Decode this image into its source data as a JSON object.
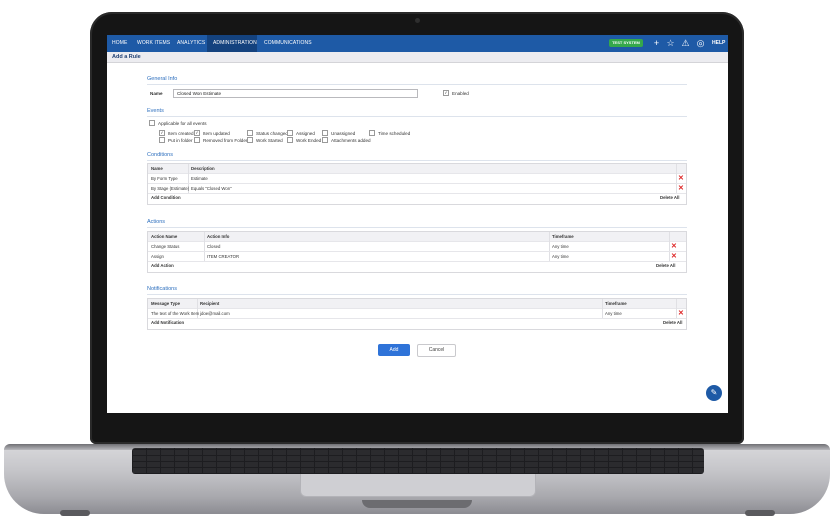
{
  "nav": {
    "items": [
      "HOME",
      "WORK ITEMS",
      "ANALYTICS",
      "ADMINISTRATION",
      "COMMUNICATIONS"
    ],
    "active": "ADMINISTRATION",
    "system_badge": "TEST SYSTEM",
    "icons": [
      "plus-icon",
      "star-icon",
      "alert-icon",
      "user-icon"
    ],
    "help": "HELP"
  },
  "page": {
    "title": "Add a Rule"
  },
  "general": {
    "heading": "General Info",
    "name_label": "Name",
    "name_value": "Closed Won Estimate",
    "enabled_label": "Enabled",
    "enabled": true
  },
  "events": {
    "heading": "Events",
    "applicable_all": "Applicable for all events",
    "row1": [
      {
        "label": "Item created",
        "checked": true
      },
      {
        "label": "Item updated",
        "checked": true
      },
      {
        "label": "Status changed",
        "checked": false
      },
      {
        "label": "Assigned",
        "checked": false
      },
      {
        "label": "Unassigned",
        "checked": false
      },
      {
        "label": "Time scheduled",
        "checked": false
      }
    ],
    "row2": [
      {
        "label": "Put in folder",
        "checked": false
      },
      {
        "label": "Removed from Folder",
        "checked": false
      },
      {
        "label": "Work Started",
        "checked": false
      },
      {
        "label": "Work Ended",
        "checked": false
      },
      {
        "label": "Attachments added",
        "checked": false
      }
    ]
  },
  "conditions": {
    "heading": "Conditions",
    "columns": [
      "Name",
      "Description"
    ],
    "rows": [
      {
        "name": "By Form Type",
        "description": "Estimate"
      },
      {
        "name": "By Stage (Estimate)",
        "description": "Equals \"Closed Won\""
      }
    ],
    "add": "Add Condition",
    "delete_all": "Delete All"
  },
  "actions": {
    "heading": "Actions",
    "columns": [
      "Action Name",
      "Action Info",
      "Timeframe"
    ],
    "rows": [
      {
        "name": "Change Status",
        "info": "Closed",
        "timeframe": "Any time"
      },
      {
        "name": "Assign",
        "info": "ITEM CREATOR",
        "timeframe": "Any time"
      }
    ],
    "add": "Add Action",
    "delete_all": "Delete All"
  },
  "notifications": {
    "heading": "Notifications",
    "columns": [
      "Message Type",
      "Recipient",
      "Timeframe"
    ],
    "rows": [
      {
        "type": "The text of the Work Item",
        "recipient": "jdoe@mail.com",
        "timeframe": "Any time"
      }
    ],
    "add": "Add Notification",
    "delete_all": "Delete All"
  },
  "buttons": {
    "add": "Add",
    "cancel": "Cancel"
  },
  "colors": {
    "nav": "#1e5aa6",
    "nav_active": "#14427e",
    "badge": "#35a84b",
    "primary": "#2f73d8",
    "delete": "#dd2222"
  }
}
